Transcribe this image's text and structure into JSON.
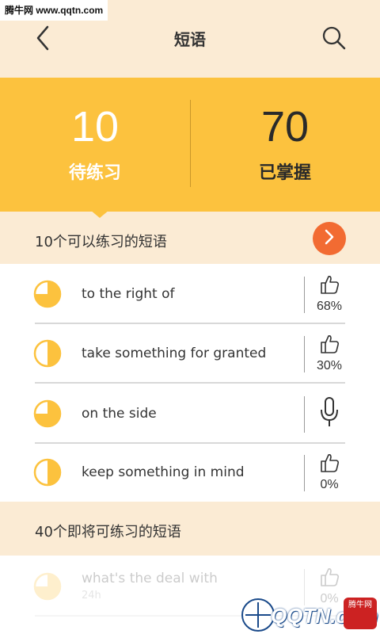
{
  "watermark_top": "腾牛网 www.qqtn.com",
  "header": {
    "title": "短语",
    "back_icon": "chevron-left-icon",
    "search_icon": "search-icon"
  },
  "stats": {
    "pending": {
      "value": "10",
      "label": "待练习"
    },
    "mastered": {
      "value": "70",
      "label": "已掌握"
    }
  },
  "section1": {
    "title": "10个可以练习的短语",
    "go_icon": "chevron-right-icon"
  },
  "phrases": [
    {
      "text": "to the right of",
      "progress": 0.75,
      "action": "thumbs-up-icon",
      "percent": "68%"
    },
    {
      "text": "take something for granted",
      "progress": 0.5,
      "action": "thumbs-up-icon",
      "percent": "30%"
    },
    {
      "text": "on the side",
      "progress": 0.75,
      "action": "microphone-icon",
      "percent": ""
    },
    {
      "text": "keep something in mind",
      "progress": 0.5,
      "action": "thumbs-up-icon",
      "percent": "0%"
    }
  ],
  "section2": {
    "title": "40个即将可练习的短语"
  },
  "upcoming": [
    {
      "text": "what's the deal with",
      "sub": "24h",
      "percent": "0%",
      "action": "thumbs-up-icon",
      "progress": 0.75
    }
  ],
  "colors": {
    "accent": "#fcc23e",
    "header_bg": "#fbebd4",
    "go_button": "#f26b32"
  },
  "watermark_bottom": {
    "text": "QQTN.com",
    "badge": "腾牛网"
  }
}
